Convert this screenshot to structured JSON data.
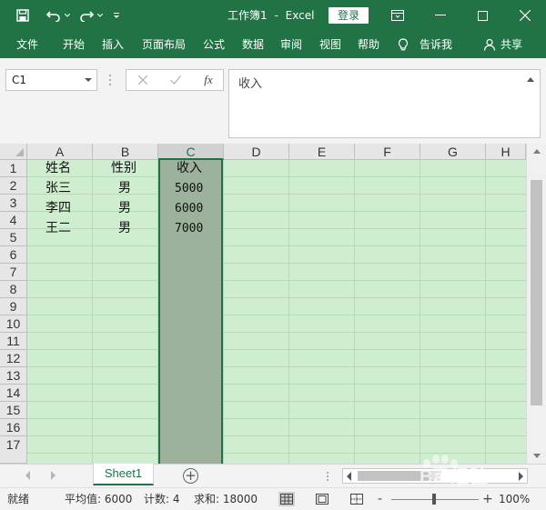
{
  "window": {
    "doc_name": "工作簿1",
    "separator": "-",
    "app_name": "Excel",
    "login_label": "登录"
  },
  "menu": {
    "items": [
      "文件",
      "开始",
      "插入",
      "页面布局",
      "公式",
      "数据",
      "审阅",
      "视图",
      "帮助"
    ],
    "tell_me": "告诉我",
    "share": "共享"
  },
  "formula_bar": {
    "name_box": "C1",
    "content": "收入",
    "fx_label": "fx"
  },
  "sheet": {
    "columns": [
      "A",
      "B",
      "C",
      "D",
      "E",
      "F",
      "G",
      "H"
    ],
    "selected_column": "C",
    "rows": [
      "1",
      "2",
      "3",
      "4",
      "5",
      "6",
      "7",
      "8",
      "9",
      "10",
      "11",
      "12",
      "13",
      "14",
      "15",
      "16",
      "17"
    ],
    "cells": {
      "A1": "姓名",
      "B1": "性别",
      "C1": "收入",
      "A2": "张三",
      "B2": "男",
      "C2": "5000",
      "A3": "李四",
      "B3": "男",
      "C3": "6000",
      "A4": "王二",
      "B4": "男",
      "C4": "7000"
    }
  },
  "tabs": {
    "sheets": [
      "Sheet1"
    ],
    "active": "Sheet1",
    "add_label": "+"
  },
  "status": {
    "mode": "就绪",
    "average_label": "平均值:",
    "average_value": "6000",
    "count_label": "计数:",
    "count_value": "4",
    "sum_label": "求和:",
    "sum_value": "18000",
    "zoom_minus": "-",
    "zoom_plus": "+",
    "zoom": "100%"
  },
  "watermark_text": "Bai经验",
  "colors": {
    "excel_green": "#217346",
    "grid_green": "#cfeecf",
    "selected_fill": "#9db29d"
  }
}
